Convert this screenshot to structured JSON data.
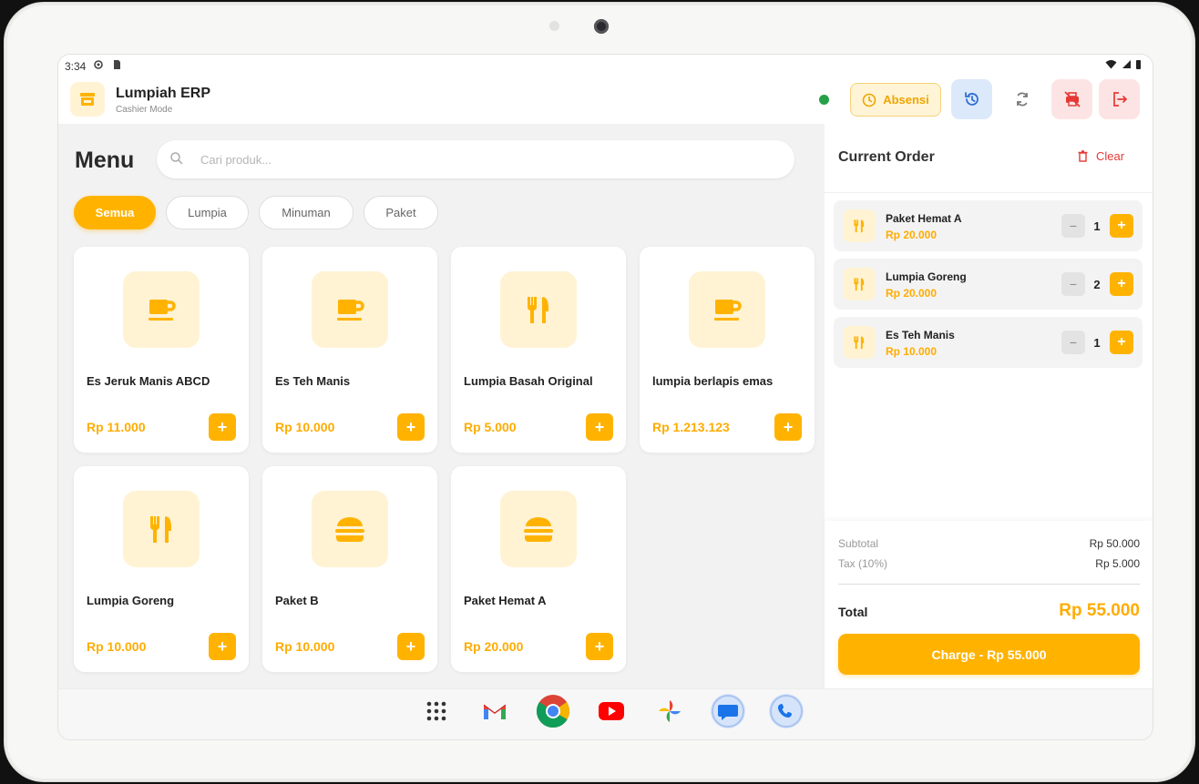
{
  "status_bar": {
    "time": "3:34"
  },
  "header": {
    "app_title": "Lumpiah ERP",
    "app_subtitle": "Cashier Mode",
    "absensi_label": "Absensi",
    "colors": {
      "accent": "#ffb300",
      "online": "#24a148",
      "danger": "#e53935"
    }
  },
  "menu": {
    "title": "Menu",
    "search_placeholder": "Cari produk...",
    "categories": [
      {
        "label": "Semua",
        "active": true
      },
      {
        "label": "Lumpia",
        "active": false
      },
      {
        "label": "Minuman",
        "active": false
      },
      {
        "label": "Paket",
        "active": false
      }
    ],
    "products": [
      {
        "name": "Es Jeruk Manis ABCD",
        "price": "Rp 11.000",
        "icon": "cup-icon"
      },
      {
        "name": "Es Teh Manis",
        "price": "Rp 10.000",
        "icon": "cup-icon"
      },
      {
        "name": "Lumpia Basah Original",
        "price": "Rp 5.000",
        "icon": "utensils-icon"
      },
      {
        "name": "lumpia berlapis emas",
        "price": "Rp 1.213.123",
        "icon": "cup-icon"
      },
      {
        "name": "Lumpia Goreng",
        "price": "Rp 10.000",
        "icon": "utensils-icon"
      },
      {
        "name": "Paket B",
        "price": "Rp 10.000",
        "icon": "burger-icon"
      },
      {
        "name": "Paket Hemat A",
        "price": "Rp 20.000",
        "icon": "burger-icon"
      }
    ]
  },
  "order": {
    "title": "Current Order",
    "clear_label": "Clear",
    "items": [
      {
        "name": "Paket Hemat A",
        "price": "Rp 20.000",
        "qty": "1"
      },
      {
        "name": "Lumpia Goreng",
        "price": "Rp 20.000",
        "qty": "2"
      },
      {
        "name": "Es Teh Manis",
        "price": "Rp 10.000",
        "qty": "1"
      }
    ],
    "subtotal_label": "Subtotal",
    "subtotal_value": "Rp 50.000",
    "tax_label": "Tax (10%)",
    "tax_value": "Rp 5.000",
    "total_label": "Total",
    "total_value": "Rp 55.000",
    "charge_label": "Charge - Rp 55.000"
  },
  "dock": {
    "apps": [
      "app-drawer-icon",
      "gmail-icon",
      "chrome-icon",
      "youtube-icon",
      "photos-icon",
      "messages-icon",
      "phone-icon"
    ]
  }
}
